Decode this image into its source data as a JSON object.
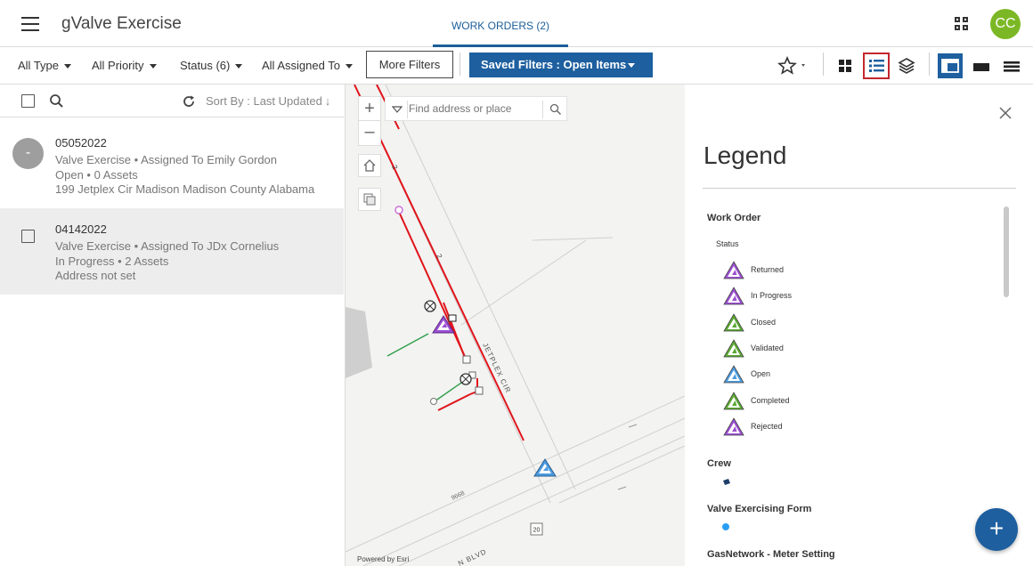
{
  "header": {
    "app_title": "gValve Exercise",
    "tab_label": "WORK ORDERS (2)",
    "avatar_initials": "CC"
  },
  "filters": {
    "type": "All Type",
    "priority": "All Priority",
    "status": "Status (6)",
    "assigned": "All Assigned To",
    "more_filters": "More Filters",
    "saved_filters": "Saved Filters : Open Items"
  },
  "list": {
    "sort_label": "Sort By : Last Updated",
    "items": [
      {
        "id": "05052022",
        "line1": "Valve Exercise • Assigned To Emily Gordon",
        "line2": "Open • 0 Assets",
        "line3": "199 Jetplex Cir Madison Madison County Alabama",
        "badge": "-"
      },
      {
        "id": "04142022",
        "line1": "Valve Exercise • Assigned To JDx Cornelius",
        "line2": "In Progress • 2 Assets",
        "line3": "Address not set"
      }
    ]
  },
  "map": {
    "search_placeholder": "Find address or place",
    "powered_by": "Powered by Esri",
    "labels": {
      "street_jetplex": "JETPLEX CIR",
      "street_blvd": "N BLVD",
      "num_9668": "9668",
      "route_20": "20",
      "pipe_label_a": "2",
      "pipe_label_b": "2"
    }
  },
  "legend": {
    "title": "Legend",
    "work_order_heading": "Work Order",
    "status_sub": "Status",
    "statuses": [
      {
        "label": "Returned",
        "color": "#9b4fd1"
      },
      {
        "label": "In Progress",
        "color": "#9b4fd1"
      },
      {
        "label": "Closed",
        "color": "#5aa832"
      },
      {
        "label": "Validated",
        "color": "#5aa832"
      },
      {
        "label": "Open",
        "color": "#4b9be0"
      },
      {
        "label": "Completed",
        "color": "#5aa832"
      },
      {
        "label": "Rejected",
        "color": "#9b4fd1"
      }
    ],
    "crew_heading": "Crew",
    "valve_form_heading": "Valve Exercising Form",
    "meter_heading": "GasNetwork - Meter Setting"
  },
  "colors": {
    "primary": "#1e5f9f",
    "avatar": "#7cb826",
    "selected_outline": "#c4262e",
    "gas_main": "#e0141b",
    "service_line": "#2e9e4a"
  }
}
